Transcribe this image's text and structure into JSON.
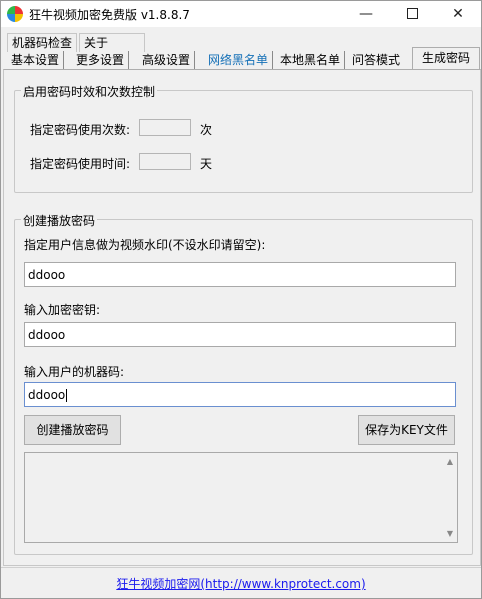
{
  "window": {
    "title": "狂牛视频加密免费版 v1.8.8.7",
    "minimize": "—",
    "close": "✕"
  },
  "tabs": {
    "row1": [
      "机器码检查",
      "关于"
    ],
    "row2": [
      "基本设置",
      "更多设置",
      "高级设置",
      "网络黑名单",
      "本地黑名单",
      "问答模式"
    ],
    "active": "生成密码"
  },
  "group_limits": {
    "title": "启用密码时效和次数控制",
    "count_label": "指定密码使用次数:",
    "count_unit": "次",
    "time_label": "指定密码使用时间:",
    "time_unit": "天"
  },
  "group_create": {
    "title": "创建播放密码",
    "watermark_label": "指定用户信息做为视频水印(不设水印请留空):",
    "watermark_value": "ddooo",
    "key_label": "输入加密密钥:",
    "key_value": "ddooo",
    "machine_label": "输入用户的机器码:",
    "machine_value": "ddooo",
    "create_button": "创建播放密码",
    "save_button": "保存为KEY文件"
  },
  "footer": {
    "site_name": "狂牛视频加密网",
    "url": "(http://www.knprotect.com)"
  },
  "colors": {
    "link": "#1570b7",
    "footer_link": "#1a1aee"
  },
  "icons": {
    "scroll_up": "▲",
    "scroll_down": "▼"
  }
}
